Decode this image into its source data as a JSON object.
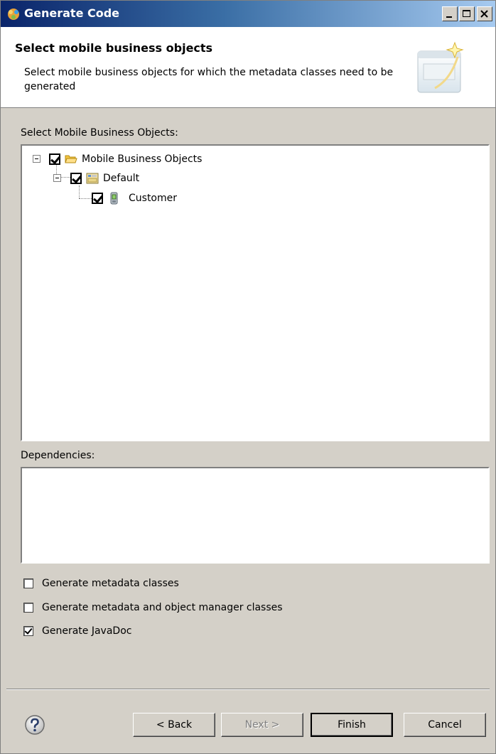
{
  "window": {
    "title": "Generate Code"
  },
  "banner": {
    "title": "Select mobile business objects",
    "description": "Select mobile business objects for which the metadata classes need to be generated"
  },
  "tree": {
    "label": "Select Mobile Business Objects:",
    "nodes": [
      {
        "label": "Mobile Business Objects",
        "checked": true,
        "icon": "folder-open-icon"
      },
      {
        "label": "Default",
        "checked": true,
        "icon": "package-icon"
      },
      {
        "label": "Customer",
        "checked": true,
        "icon": "mobile-device-icon"
      }
    ]
  },
  "dependencies": {
    "label": "Dependencies:"
  },
  "options": [
    {
      "label": "Generate metadata classes",
      "checked": false
    },
    {
      "label": "Generate metadata and object manager classes",
      "checked": false
    },
    {
      "label": "Generate JavaDoc",
      "checked": true
    }
  ],
  "buttons": {
    "back": "< Back",
    "next": "Next >",
    "finish": "Finish",
    "cancel": "Cancel"
  }
}
